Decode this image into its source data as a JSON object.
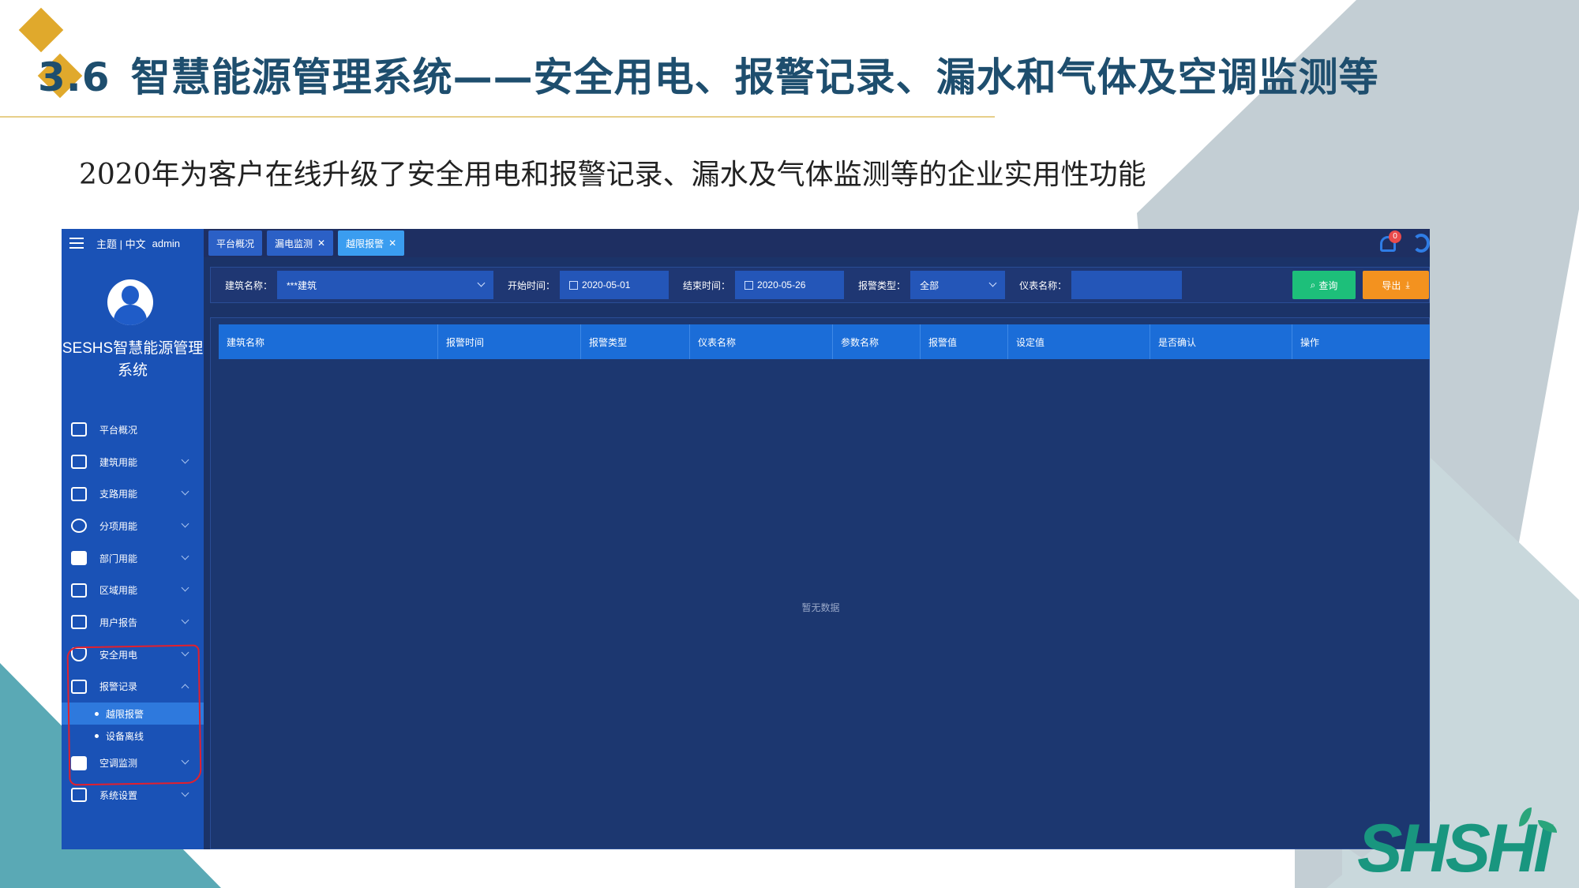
{
  "slide": {
    "number": "3.6",
    "title": "智慧能源管理系统——安全用电、报警记录、漏水和气体及空调监测等",
    "subtitle": "2020年为客户在线升级了安全用电和报警记录、漏水及气体监测等的企业实用性功能",
    "logo": "SHSHI",
    "colors": {
      "title": "#1e4e6e",
      "accent_gold": "#e0a92c",
      "logo_green": "#19967f",
      "bg_gray": "#c3ced4",
      "bg_teal": "#5aa9b5"
    }
  },
  "app": {
    "top_menu": {
      "theme_lang": "主题 | 中文",
      "user": "admin"
    },
    "system_name": "SESHS智慧能源管理系统",
    "tabs": [
      {
        "label": "平台概况",
        "closable": false
      },
      {
        "label": "漏电监测",
        "closable": true
      },
      {
        "label": "越限报警",
        "closable": true,
        "active": true
      }
    ],
    "notification_count": "0",
    "nav": [
      {
        "label": "平台概况",
        "icon": "monitor-icon"
      },
      {
        "label": "建筑用能",
        "icon": "building-icon"
      },
      {
        "label": "支路用能",
        "icon": "branch-icon"
      },
      {
        "label": "分项用能",
        "icon": "compass-icon"
      },
      {
        "label": "部门用能",
        "icon": "folder-icon"
      },
      {
        "label": "区域用能",
        "icon": "region-icon"
      },
      {
        "label": "用户报告",
        "icon": "edit-icon"
      },
      {
        "label": "安全用电",
        "icon": "shield-icon"
      },
      {
        "label": "报警记录",
        "icon": "document-icon"
      },
      {
        "label": "空调监测",
        "icon": "ac-icon"
      },
      {
        "label": "系统设置",
        "icon": "settings-icon"
      }
    ],
    "sub_nav": [
      {
        "label": "越限报警",
        "active": true
      },
      {
        "label": "设备离线",
        "active": false
      }
    ],
    "filters": {
      "building_label": "建筑名称：",
      "building_value": "***建筑",
      "start_label": "开始时间：",
      "start_value": "2020-05-01",
      "end_label": "结束时间：",
      "end_value": "2020-05-26",
      "type_label": "报警类型：",
      "type_value": "全部",
      "meter_label": "仪表名称：",
      "meter_value": "",
      "query_button": "查询",
      "export_button": "导出"
    },
    "table": {
      "columns": [
        "建筑名称",
        "报警时间",
        "报警类型",
        "仪表名称",
        "参数名称",
        "报警值",
        "设定值",
        "是否确认",
        "操作"
      ],
      "empty_text": "暂无数据"
    }
  }
}
